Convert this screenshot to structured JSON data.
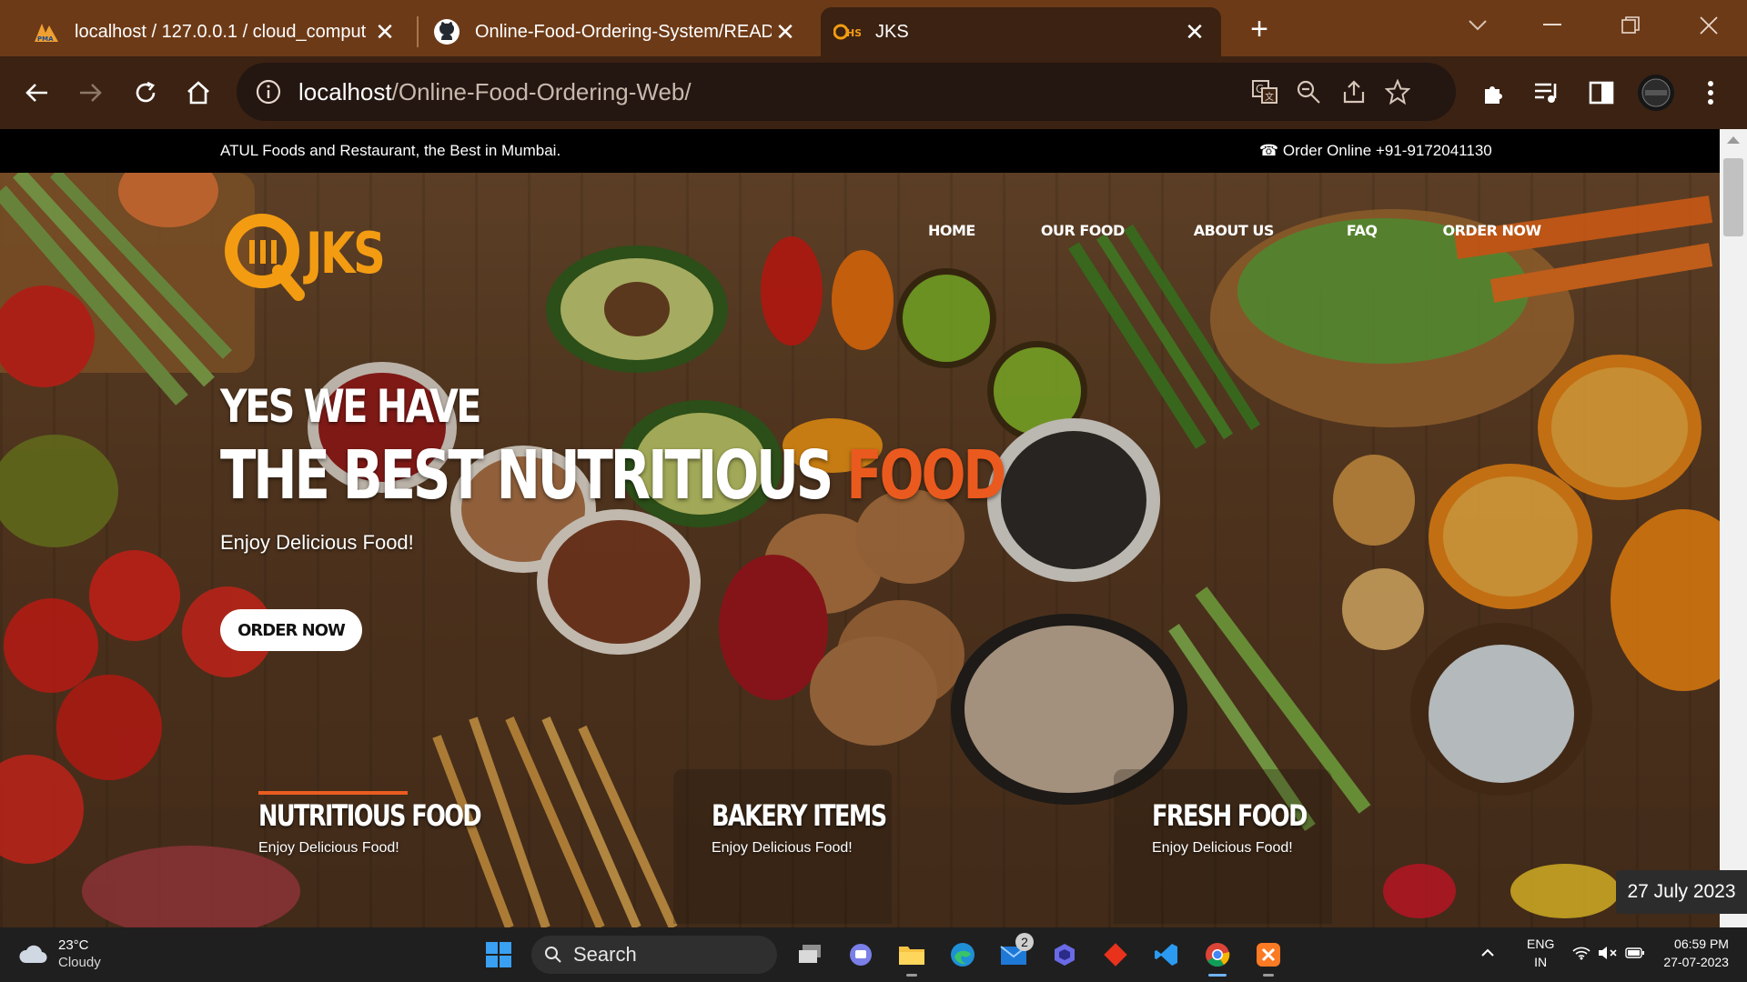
{
  "browser": {
    "tabs": [
      {
        "title": "localhost / 127.0.0.1 / cloud_comput",
        "icon": "phpmyadmin-icon",
        "active": false
      },
      {
        "title": "Online-Food-Ordering-System/READ",
        "icon": "github-icon",
        "active": false
      },
      {
        "title": "JKS",
        "icon": "jks-favicon",
        "active": true
      }
    ],
    "url_host": "localhost",
    "url_path": "/Online-Food-Ordering-Web/"
  },
  "topbar": {
    "tagline": "ATUL Foods and Restaurant, the Best in Mumbai.",
    "order_online": "☎ Order Online +91-9172041130"
  },
  "site": {
    "logo_text": "JKS",
    "nav": [
      "HOME",
      "OUR FOOD",
      "ABOUT US",
      "FAQ",
      "ORDER NOW"
    ],
    "hero": {
      "line1": "YES WE HAVE",
      "line2_main": "THE BEST NUTRITIOUS ",
      "line2_accent": "FOOD",
      "subtitle": "Enjoy Delicious Food!",
      "button": "ORDER NOW"
    },
    "cards": [
      {
        "title": "NUTRITIOUS FOOD",
        "subtitle": "Enjoy Delicious Food!"
      },
      {
        "title": "BAKERY ITEMS",
        "subtitle": "Enjoy Delicious Food!"
      },
      {
        "title": "FRESH FOOD",
        "subtitle": "Enjoy Delicious Food!"
      }
    ],
    "date_toast": "27 July 2023"
  },
  "taskbar": {
    "weather_temp": "23°C",
    "weather_desc": "Cloudy",
    "search_label": "Search",
    "mail_badge": "2",
    "lang_1": "ENG",
    "lang_2": "IN",
    "time": "06:59 PM",
    "date": "27-07-2023"
  },
  "colors": {
    "tabbar": "#6d3a17",
    "toolbar": "#3b2212",
    "accent_orange": "#ea5a1e",
    "logo_orange": "#f39c12"
  }
}
